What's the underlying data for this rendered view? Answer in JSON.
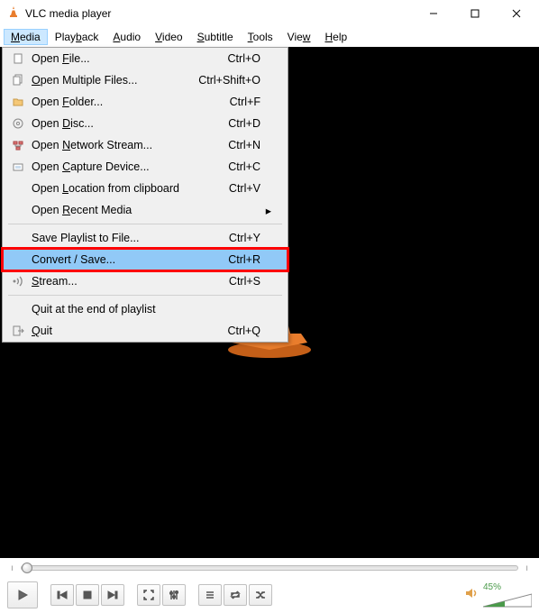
{
  "title": "VLC media player",
  "menubar": [
    {
      "label": "Media",
      "accel_index": 0,
      "open": true
    },
    {
      "label": "Playback",
      "accel_index": 4
    },
    {
      "label": "Audio",
      "accel_index": 0
    },
    {
      "label": "Video",
      "accel_index": 0
    },
    {
      "label": "Subtitle",
      "accel_index": 0
    },
    {
      "label": "Tools",
      "accel_index": 0
    },
    {
      "label": "View",
      "accel_index": 3
    },
    {
      "label": "Help",
      "accel_index": 0
    }
  ],
  "dropdown": {
    "groups": [
      [
        {
          "icon": "file",
          "label": "Open File...",
          "accel": "F",
          "shortcut": "Ctrl+O"
        },
        {
          "icon": "files",
          "label": "Open Multiple Files...",
          "accel": "O",
          "shortcut": "Ctrl+Shift+O"
        },
        {
          "icon": "folder",
          "label": "Open Folder...",
          "accel": "F",
          "shortcut": "Ctrl+F"
        },
        {
          "icon": "disc",
          "label": "Open Disc...",
          "accel": "D",
          "shortcut": "Ctrl+D"
        },
        {
          "icon": "network",
          "label": "Open Network Stream...",
          "accel": "N",
          "shortcut": "Ctrl+N"
        },
        {
          "icon": "capture",
          "label": "Open Capture Device...",
          "accel": "C",
          "shortcut": "Ctrl+C"
        },
        {
          "icon": "",
          "label": "Open Location from clipboard",
          "accel": "L",
          "shortcut": "Ctrl+V"
        },
        {
          "icon": "",
          "label": "Open Recent Media",
          "accel": "R",
          "shortcut": "",
          "submenu": true
        }
      ],
      [
        {
          "icon": "",
          "label": "Save Playlist to File...",
          "accel": "",
          "shortcut": "Ctrl+Y"
        },
        {
          "icon": "",
          "label": "Convert / Save...",
          "accel": "R",
          "shortcut": "Ctrl+R",
          "highlight": true
        },
        {
          "icon": "stream",
          "label": "Stream...",
          "accel": "S",
          "shortcut": "Ctrl+S"
        }
      ],
      [
        {
          "icon": "",
          "label": "Quit at the end of playlist",
          "accel": "",
          "shortcut": ""
        },
        {
          "icon": "quit",
          "label": "Quit",
          "accel": "Q",
          "shortcut": "Ctrl+Q"
        }
      ]
    ]
  },
  "volume": {
    "percent_label": "45%",
    "value": 45
  }
}
